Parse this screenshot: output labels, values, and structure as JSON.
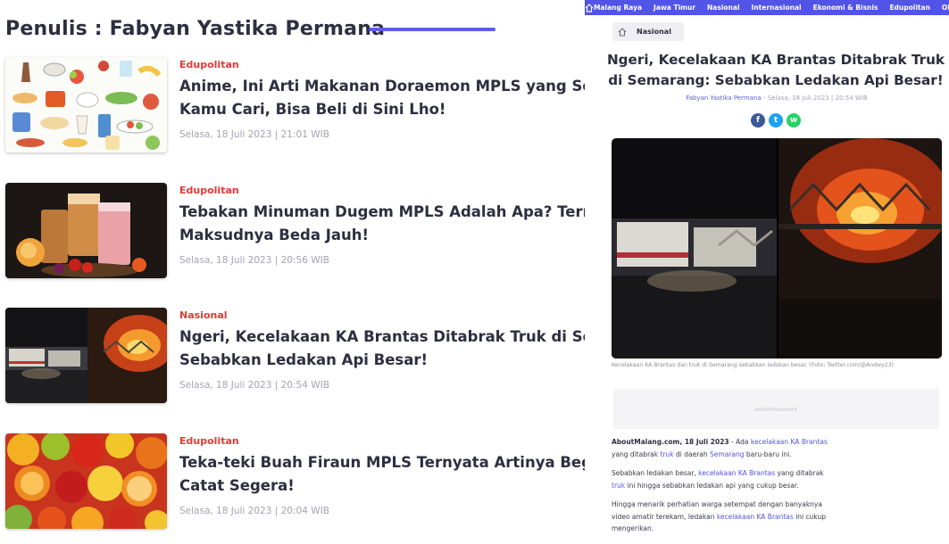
{
  "author_page": {
    "heading": "Penulis : Fabyan Yastika Permana",
    "articles": [
      {
        "category": "Edupolitan",
        "title_line1": "Anime, Ini Arti Makanan Doraemon MPLS yang Seda",
        "title_line2": "Kamu Cari, Bisa Beli di Sini Lho!",
        "date": "Selasa, 18 Juli 2023 | 21:01 WIB"
      },
      {
        "category": "Edupolitan",
        "title_line1": "Tebakan Minuman Dugem MPLS Adalah Apa? Terny",
        "title_line2": "Maksudnya Beda Jauh!",
        "date": "Selasa, 18 Juli 2023 | 20:56 WIB"
      },
      {
        "category": "Nasional",
        "title_line1": "Ngeri, Kecelakaan KA Brantas Ditabrak Truk di Semc",
        "title_line2": "Sebabkan Ledakan Api Besar!",
        "date": "Selasa, 18 Juli 2023 | 20:54 WIB"
      },
      {
        "category": "Edupolitan",
        "title_line1": "Teka-teki Buah Firaun MPLS Ternyata Artinya Begini",
        "title_line2": "Catat Segera!",
        "date": "Selasa, 18 Juli 2023 | 20:04 WIB"
      }
    ]
  },
  "article_page": {
    "nav": [
      "Malang Raya",
      "Jawa Timur",
      "Nasional",
      "Internasional",
      "Ekonomi & Bisnis",
      "Edupolitan",
      "Olahraga"
    ],
    "breadcrumb": "Nasional",
    "headline_line1": "Ngeri, Kecelakaan KA Brantas Ditabrak Truk",
    "headline_line2": "di Semarang: Sebabkan Ledakan Api Besar!",
    "byline_author": "Fabyan Yastika Permana",
    "byline_rest": " - Selasa, 18 Juli 2023 | 20:54 WIB",
    "share": {
      "facebook": "f",
      "twitter": "t",
      "whatsapp": "w"
    },
    "caption": "Kecelakaan KA Brantas dan truk di Semarang sebabkan ledakan besar. (Foto: Twitter.com/@Andwy23)",
    "ad_label": "Advertisement",
    "p1": {
      "a": "AboutMalang.com, 18 Juli 2023",
      "b": " - Ada ",
      "c": "kecelakaan KA Brantas",
      "d": "yang ditabrak ",
      "e": "truk",
      "f": " di daerah ",
      "g": "Semarang",
      "h": " baru-baru ini."
    },
    "p2": {
      "a": "Sebabkan ledakan besar, ",
      "b": "kecelakaan KA Brantas",
      "c": " yang ditabrak",
      "d": "truk",
      "e": " ini hingga sebabkan ledakan api yang cukup besar."
    },
    "p3": {
      "a": "Hingga menarik perhatian warga setempat dengan banyaknya",
      "b": "video amatir terekam, ledakan ",
      "c": "kecelakaan KA Brantas",
      "d": " ini cukup",
      "e": "mengerikan."
    },
    "colors": {
      "accent": "#5154e6",
      "category": "#e53935",
      "muted": "#a3a3b2"
    }
  }
}
